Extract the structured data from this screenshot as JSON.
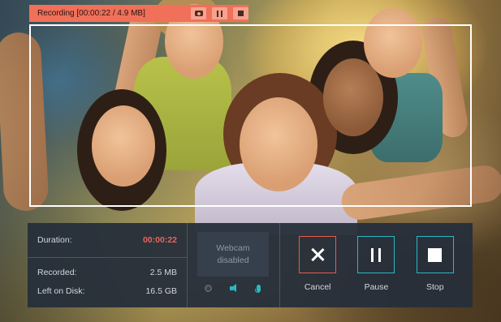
{
  "recording_bar": {
    "status": "Recording [00:00:22 / 4.9 MB]",
    "snapshot_icon": "camera-icon",
    "pause_icon": "pause-icon",
    "stop_icon": "stop-icon",
    "color": "#f0705a"
  },
  "info": {
    "duration_label": "Duration:",
    "duration_value": "00:00:22",
    "recorded_label": "Recorded:",
    "recorded_value": "2.5 MB",
    "left_label": "Left on Disk:",
    "left_value": "16.5 GB"
  },
  "webcam": {
    "status": "Webcam disabled",
    "icons": [
      "webcam-icon",
      "speaker-icon",
      "microphone-icon"
    ]
  },
  "actions": {
    "cancel_label": "Cancel",
    "pause_label": "Pause",
    "stop_label": "Stop"
  },
  "colors": {
    "accent": "#29b9c4",
    "cancel": "#e85a4a",
    "duration": "#e8655a",
    "panel": "#262e3a"
  }
}
